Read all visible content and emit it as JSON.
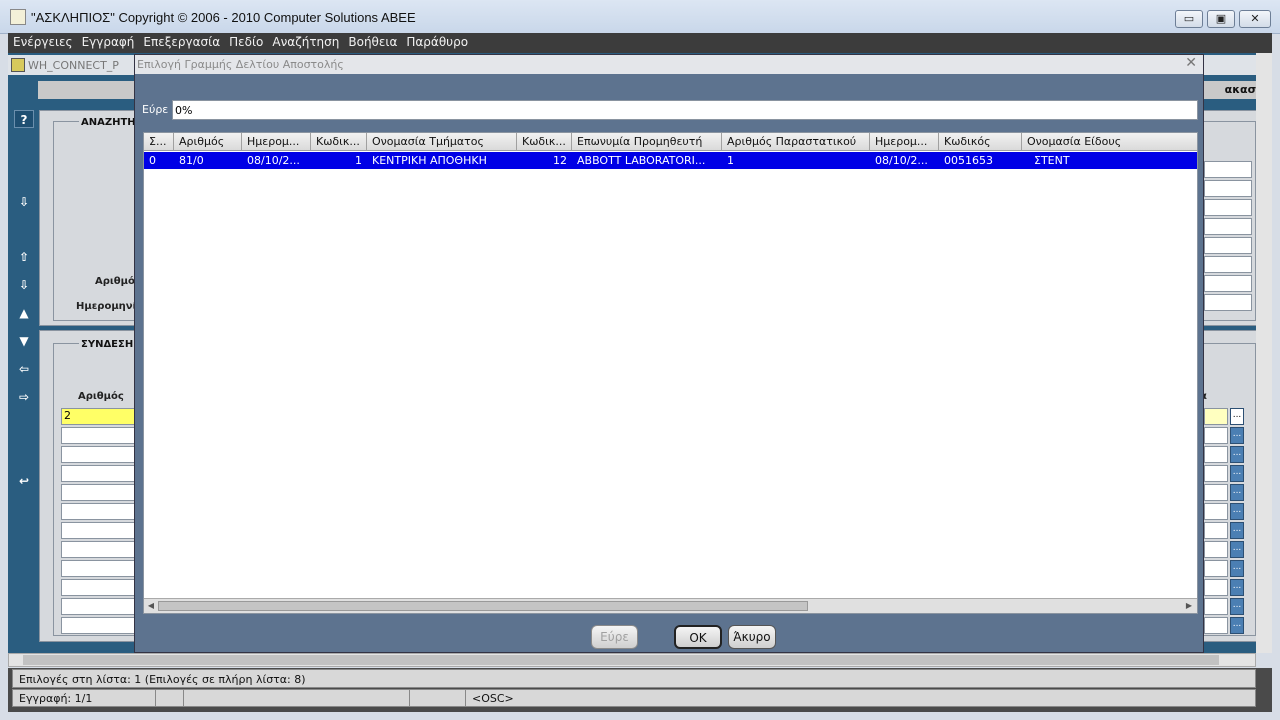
{
  "window": {
    "title": "\"ΑΣΚΛΗΠΙΟΣ\" Copyright © 2006 - 2010 Computer Solutions ABEE",
    "minimize": "▭",
    "maximize": "▣",
    "close": "✕"
  },
  "menu": [
    "Ενέργειες",
    "Εγγραφή",
    "Επεξεργασία",
    "Πεδίο",
    "Αναζήτηση",
    "Βοήθεια",
    "Παράθυρο"
  ],
  "background": {
    "form_title": "WH_CONNECT_P",
    "right_header": "ακασία",
    "section_search": "ΑΝΑΖΗΤΗ",
    "label_number": "Αριθμό",
    "label_date": "Ημερομηνί",
    "section_link": "ΣΥΝΔΕΣΗ",
    "col_number": "Αριθμός",
    "first_value": "2",
    "right_col_frag": "α",
    "toolbar": {
      "help": "?",
      "save": "⇩",
      "first": "⇧",
      "last": "⇩",
      "prev": "▲",
      "next": "▼",
      "back": "⇦",
      "forward": "⇨",
      "exit": "↩"
    },
    "ellipsis": "..."
  },
  "dialog": {
    "title": "Επιλογή Γραμμής Δελτίου Αποστολής",
    "close": "✕",
    "find_label": "Εύρε",
    "find_value": "0%",
    "columns": [
      "Σ...",
      "Αριθμός",
      "Ημερομ...",
      "Κωδικ...",
      "Ονομασία Τμήματος",
      "Κωδικ...",
      "Επωνυμία Προμηθευτή",
      "Αριθμός Παραστατικού",
      "Ημερομ...",
      "Κωδικός",
      "Ονομασία Είδους"
    ],
    "rows": [
      [
        "0",
        "81/0",
        "08/10/2...",
        "1",
        "ΚΕΝΤΡΙΚΗ ΑΠΟΘΗΚΗ",
        "12",
        "ABBOTT LABORATORI...",
        "1",
        "08/10/2...",
        "0051653",
        "ΣΤΕΝΤ"
      ]
    ],
    "buttons": {
      "find": "Εύρε",
      "ok": "OK",
      "cancel": "Άκυρο"
    },
    "scroll_left": "◀",
    "scroll_right": "▶"
  },
  "status": {
    "line1": "Επιλογές στη λίστα: 1 (Επιλογές σε πλήρη λίστα: 8)",
    "record": "Εγγραφή: 1/1",
    "osc": "<OSC>"
  }
}
